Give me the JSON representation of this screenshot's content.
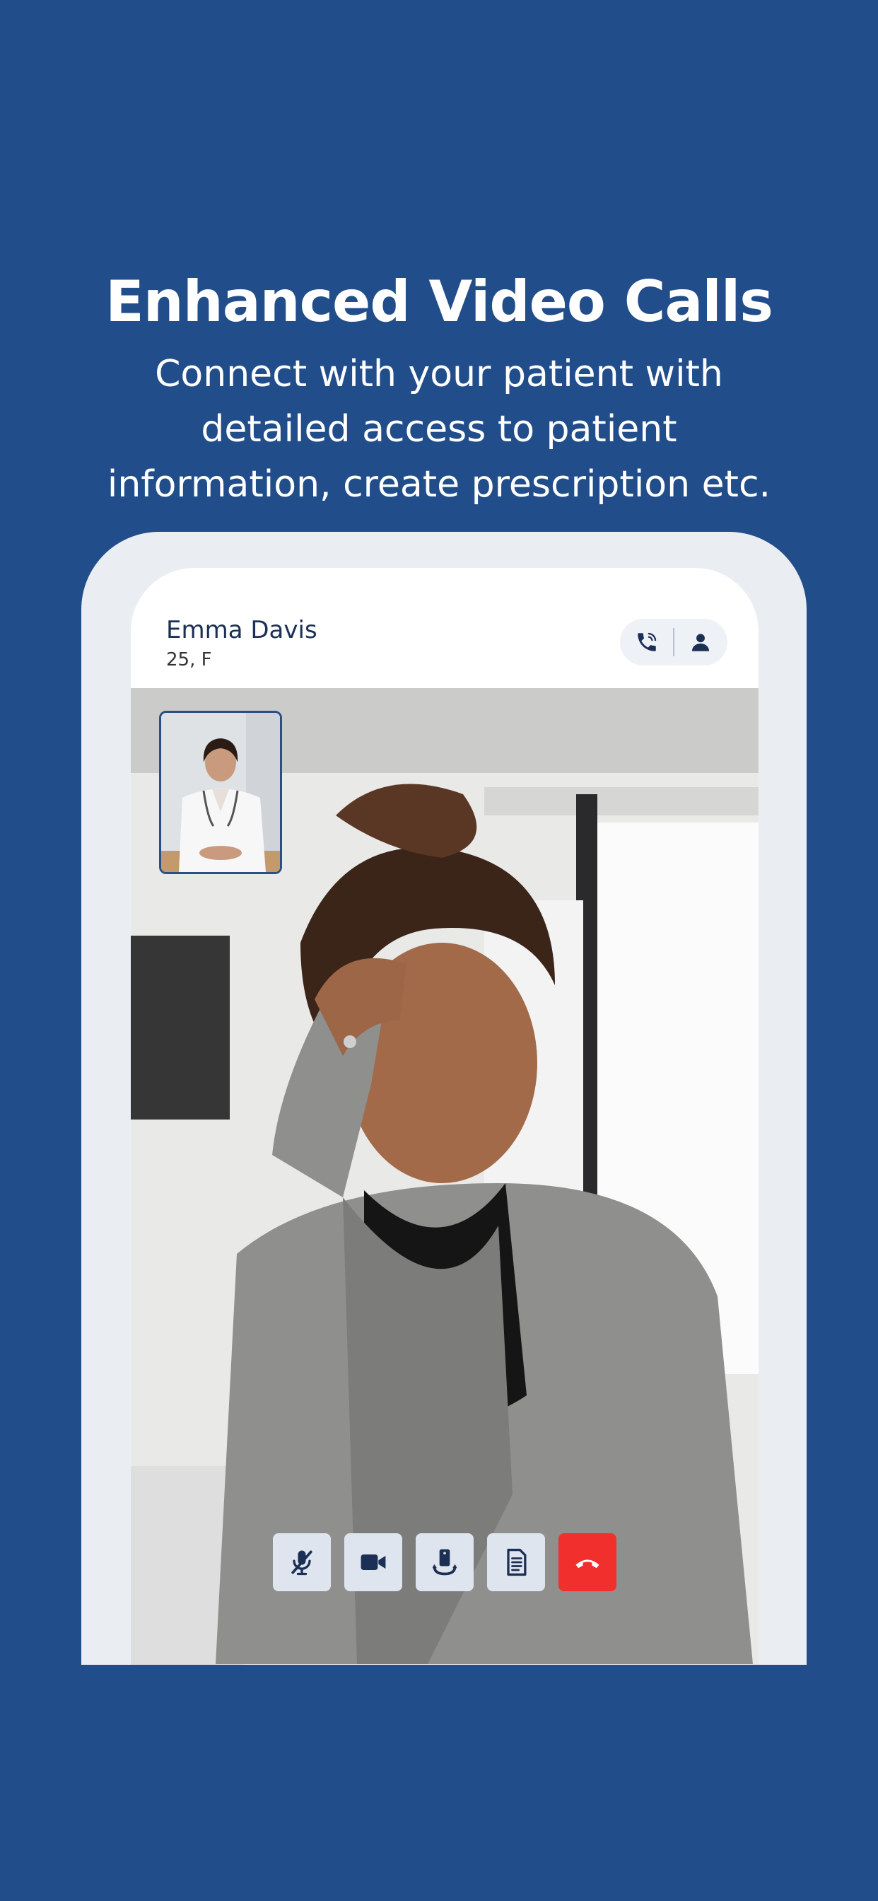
{
  "promo": {
    "headline": "Enhanced Video Calls",
    "subline": "Connect with your patient with detailed access to patient information, create prescription etc."
  },
  "call": {
    "patient_name": "Emma Davis",
    "patient_meta": "25, F",
    "header_actions": [
      "phone-icon",
      "user-icon"
    ],
    "controls": [
      "mute-mic-icon",
      "video-camera-icon",
      "flip-camera-icon",
      "document-icon",
      "end-call-icon"
    ]
  },
  "colors": {
    "background": "#214d8a",
    "phone_frame": "#eaeef2",
    "navy": "#1c2f55",
    "control_bg": "#dfe5ee",
    "end_call": "#f1302d"
  }
}
